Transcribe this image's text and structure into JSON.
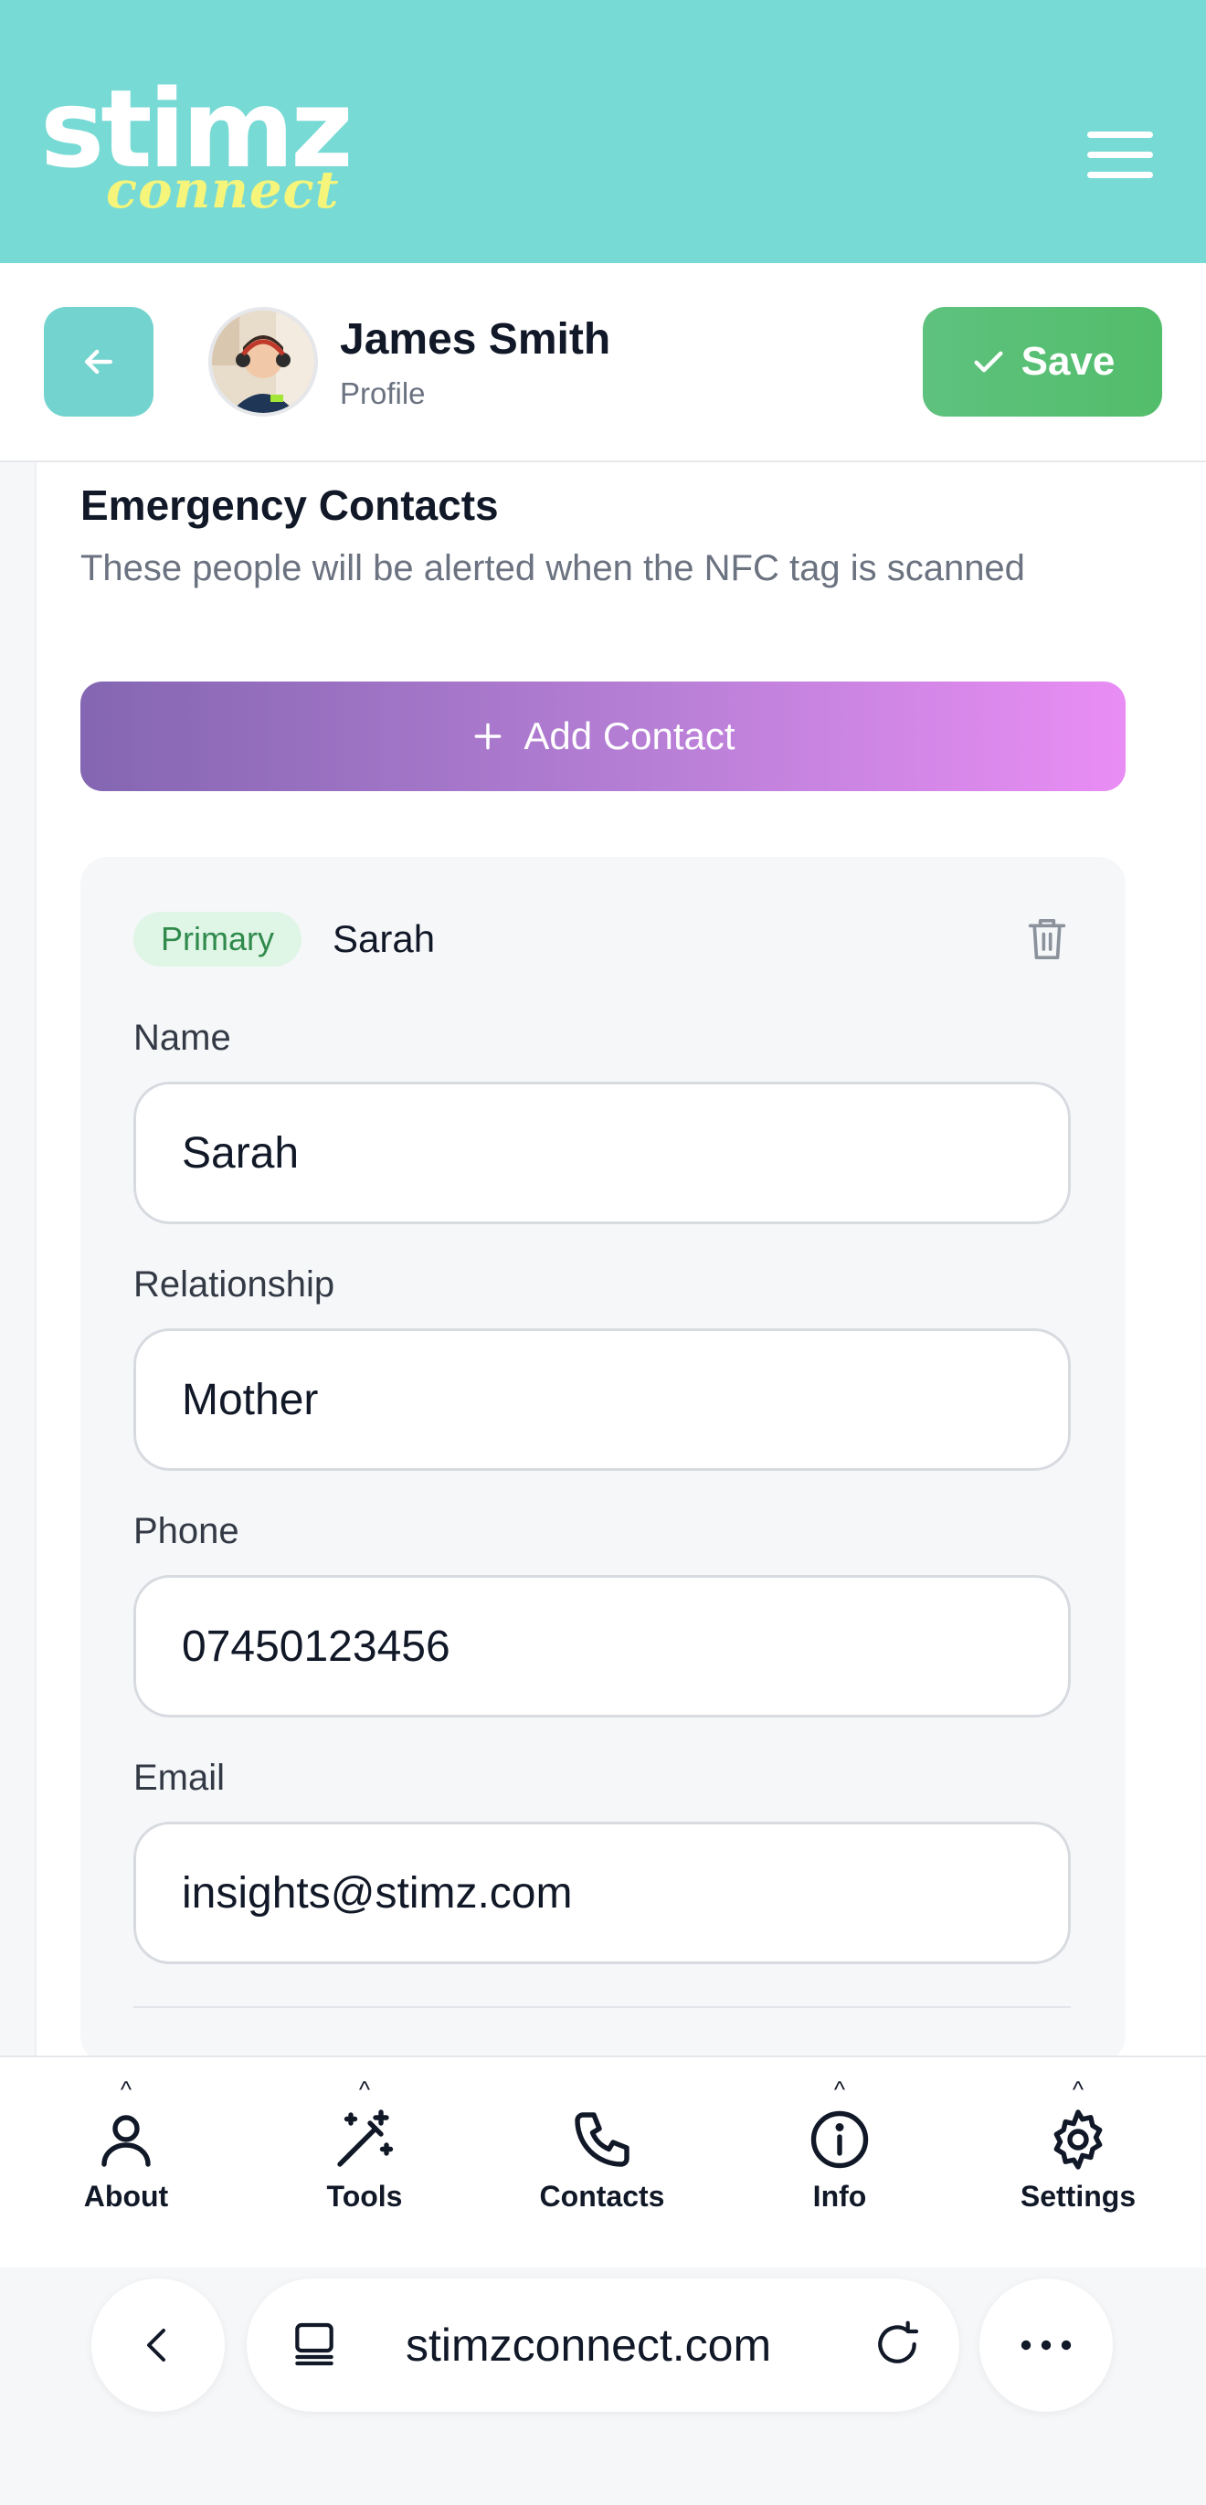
{
  "brand": {
    "logo_word": "stimz",
    "logo_sub": "connect",
    "colors": {
      "teal": "#78dad5",
      "logo_yellow": "#f4f57a"
    }
  },
  "header": {
    "menu_icon": "hamburger-menu-icon"
  },
  "profile_bar": {
    "back_icon": "arrow-left-icon",
    "name": "James Smith",
    "subtitle": "Profile",
    "save_label": "Save",
    "save_icon": "check-icon",
    "save_color": "#5ec27e"
  },
  "emergency": {
    "title": "Emergency Contacts",
    "description": "These people will be alerted when the NFC tag is scanned",
    "add_label": "Add Contact",
    "add_icon": "plus-icon"
  },
  "contact": {
    "badge": "Primary",
    "name": "Sarah",
    "delete_icon": "trash-icon",
    "fields": {
      "name_label": "Name",
      "name_value": "Sarah",
      "relationship_label": "Relationship",
      "relationship_value": "Mother",
      "phone_label": "Phone",
      "phone_value": "07450123456",
      "email_label": "Email",
      "email_value": "insights@stimz.com"
    }
  },
  "bottom_nav": {
    "items": [
      {
        "label": "About",
        "icon": "user-icon",
        "has_caret": true
      },
      {
        "label": "Tools",
        "icon": "magic-wand-icon",
        "has_caret": true
      },
      {
        "label": "Contacts",
        "icon": "phone-icon",
        "has_caret": false
      },
      {
        "label": "Info",
        "icon": "info-icon",
        "has_caret": true
      },
      {
        "label": "Settings",
        "icon": "gear-icon",
        "has_caret": true
      }
    ],
    "caret": "^"
  },
  "browser": {
    "url": "stimzconnect.com",
    "back_icon": "chevron-left-icon",
    "tab_icon": "tabs-icon",
    "reload_icon": "reload-icon",
    "more_icon": "more-dots-icon"
  }
}
